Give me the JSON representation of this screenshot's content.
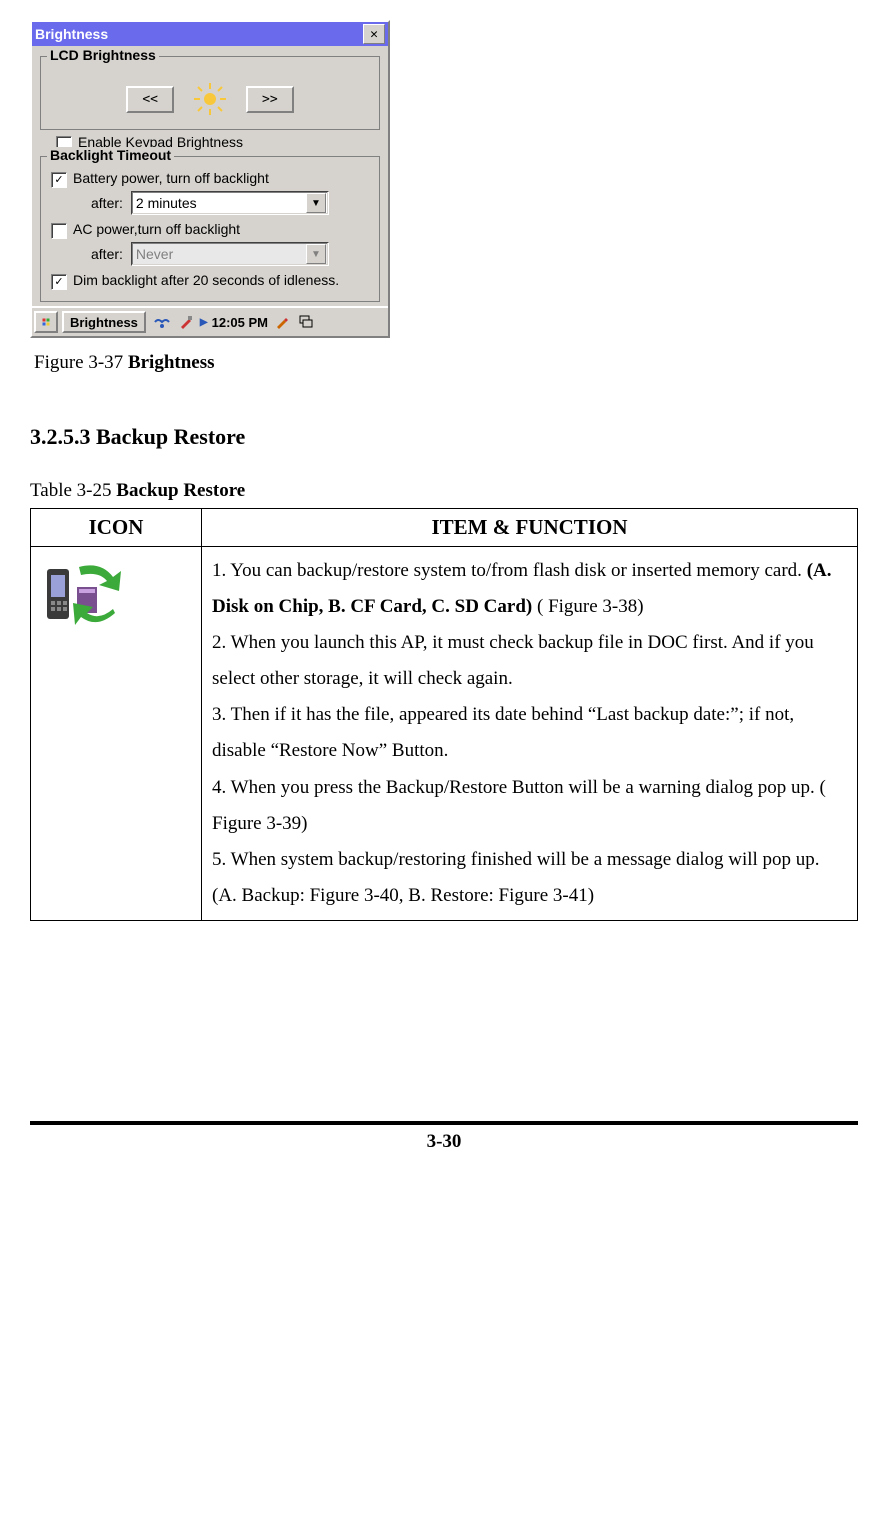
{
  "window": {
    "title": "Brightness",
    "group_lcd": {
      "legend": "LCD Brightness",
      "prev": "<<",
      "next": ">>"
    },
    "enable_keypad_label": "Enable Keypad Brightness",
    "group_backlight": {
      "legend": "Backlight Timeout",
      "battery_label": "Battery power, turn off backlight",
      "after_label": "after:",
      "battery_value": "2 minutes",
      "ac_label": "AC  power,turn off backlight",
      "ac_value": "Never",
      "dim_label": "Dim backlight after 20 seconds of idleness."
    },
    "taskbar": {
      "app_label": "Brightness",
      "clock": "12:05 PM"
    }
  },
  "figure_caption_prefix": "Figure 3-37 ",
  "figure_caption_bold": "Brightness",
  "section_heading": "3.2.5.3 Backup Restore",
  "table_caption_prefix": "Table 3-25 ",
  "table_caption_bold": "Backup Restore",
  "table": {
    "header_icon": "ICON",
    "header_func": "ITEM & FUNCTION",
    "func_item1_pre": "1. You can backup/restore system to/from flash disk or inserted memory card. ",
    "func_item1_bold": "(A. Disk on Chip, B. CF Card, C. SD Card)",
    "func_item1_post": " ( Figure 3-38)",
    "func_item2": "2. When you launch this AP, it must check backup file in DOC first. And if you select other storage, it will check again.",
    "func_item3": "3. Then if it has the file, appeared its date behind “Last backup date:”; if not, disable “Restore Now” Button.",
    "func_item4": "4. When you press the Backup/Restore Button will be a warning dialog pop up. ( Figure 3-39)",
    "func_item5": "5. When system backup/restoring finished will be a message dialog will pop up. (A. Backup: Figure 3-40, B. Restore: Figure 3-41)"
  },
  "page_number": "3-30"
}
